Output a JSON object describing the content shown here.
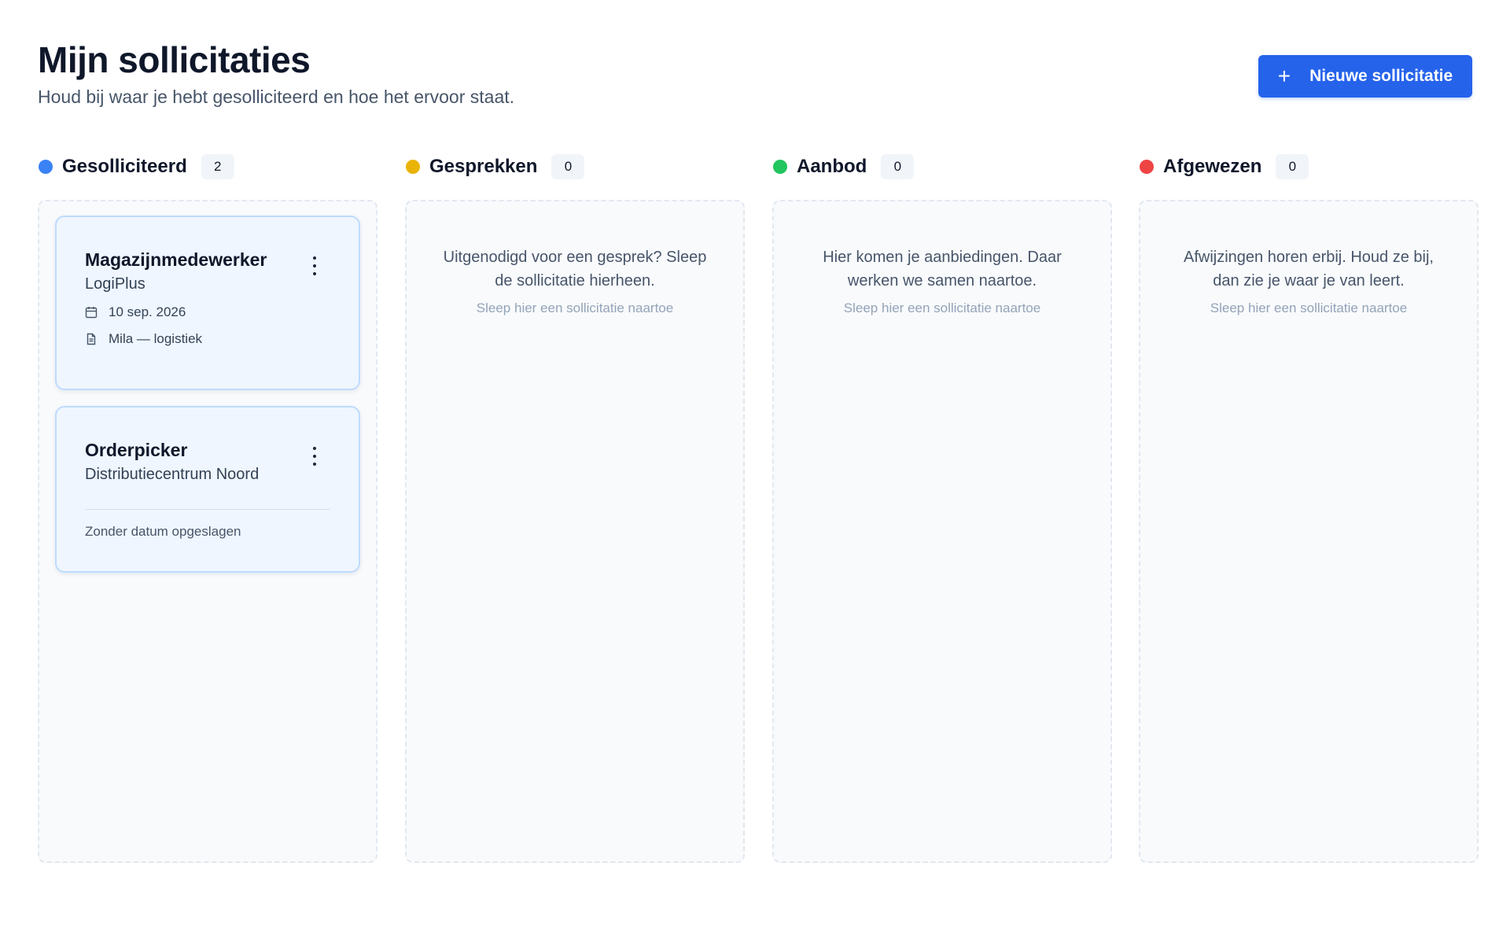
{
  "header": {
    "title": "Mijn sollicitaties",
    "subtitle": "Houd bij waar je hebt gesolliciteerd en hoe het ervoor staat.",
    "new_button_label": "Nieuwe sollicitatie",
    "new_button_icon": "plus-icon",
    "accent_color": "#2563eb"
  },
  "columns": [
    {
      "title": "Gesolliciteerd",
      "count": "2",
      "color": "#3b82f6",
      "cards": [
        {
          "title": "Magazijnmedewerker",
          "company": "LogiPlus",
          "date": "10 sep. 2026",
          "date_icon": "calendar-icon",
          "resume": "Mila — logistiek",
          "resume_icon": "document-icon"
        },
        {
          "title": "Orderpicker",
          "company": "Distributiecentrum Noord",
          "note": "Zonder datum opgeslagen"
        }
      ]
    },
    {
      "title": "Gesprekken",
      "count": "0",
      "color": "#eab308",
      "empty_text": "Uitgenodigd voor een gesprek? Sleep de sollicitatie hierheen.",
      "empty_hint": "Sleep hier een sollicitatie naartoe"
    },
    {
      "title": "Aanbod",
      "count": "0",
      "color": "#22c55e",
      "empty_text": "Hier komen je aanbiedingen. Daar werken we samen naartoe.",
      "empty_hint": "Sleep hier een sollicitatie naartoe"
    },
    {
      "title": "Afgewezen",
      "count": "0",
      "color": "#ef4444",
      "empty_text": "Afwijzingen horen erbij. Houd ze bij, dan zie je waar je van leert.",
      "empty_hint": "Sleep hier een sollicitatie naartoe"
    }
  ]
}
